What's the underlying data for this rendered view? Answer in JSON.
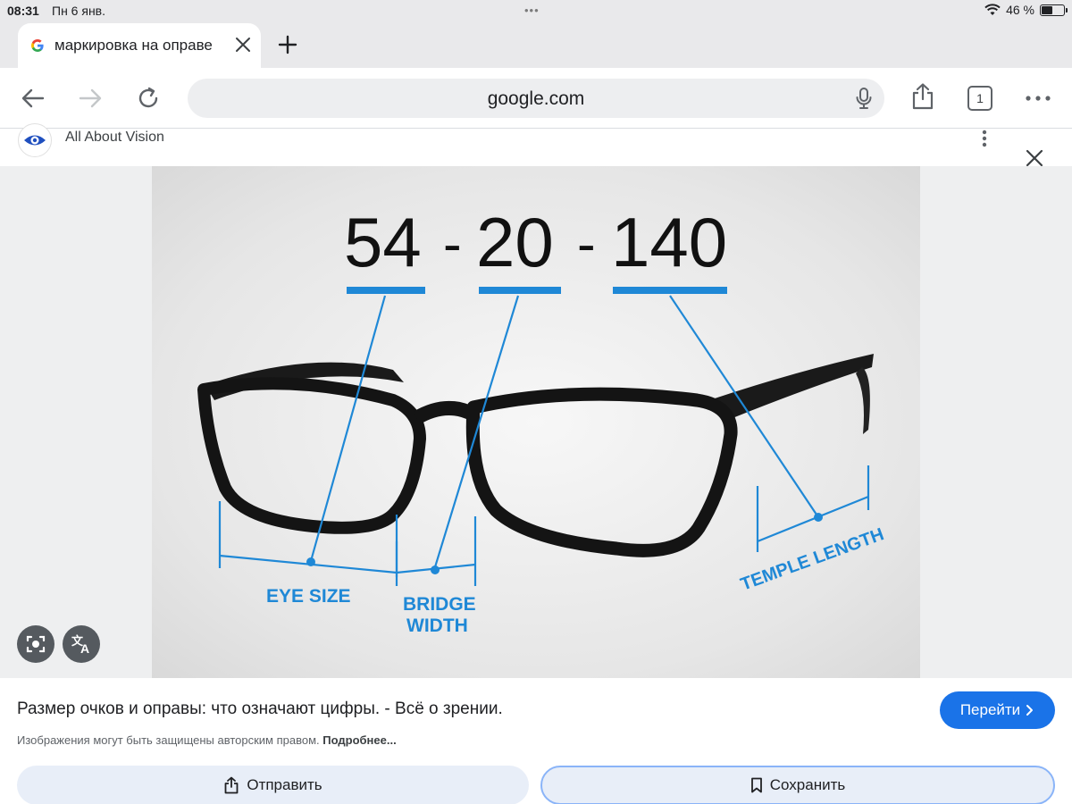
{
  "status_bar": {
    "time": "08:31",
    "date": "Пн 6 янв.",
    "dots": "•••",
    "battery": "46 %",
    "battery_level": 0.46
  },
  "tab": {
    "favicon": "google-g-icon",
    "title": "маркировка на оправе"
  },
  "toolbar": {
    "url": "google.com",
    "tab_count": "1"
  },
  "source": {
    "name": "All About Vision",
    "icon": "eye-icon"
  },
  "image": {
    "eye_size": "54",
    "dash1": "-",
    "bridge": "20",
    "dash2": "-",
    "temple": "140",
    "label_eye_size": "EYE SIZE",
    "label_bridge_1": "BRIDGE",
    "label_bridge_2": "WIDTH",
    "label_temple": "TEMPLE LENGTH",
    "accent": "#1f88d6"
  },
  "result": {
    "title": "Размер очков и оправы: что означают цифры. - Всё о зрении.",
    "visit": "Перейти",
    "copyright": "Изображения могут быть защищены авторским правом.",
    "more": "Подробнее..."
  },
  "actions": {
    "share": "Отправить",
    "save": "Сохранить"
  },
  "colors": {
    "primary": "#1a73e8",
    "chrome": "#e9e9eb"
  }
}
